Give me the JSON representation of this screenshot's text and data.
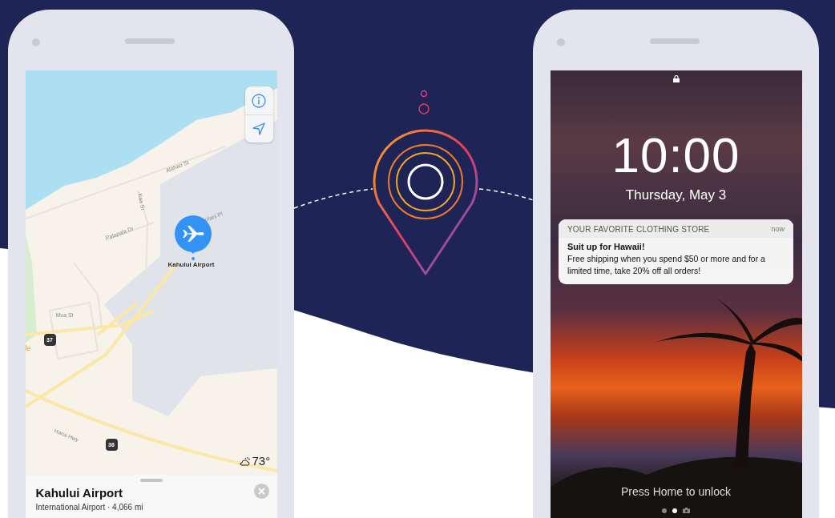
{
  "map_phone": {
    "map": {
      "labels": [
        {
          "kind": "street",
          "text": "Alahao St"
        },
        {
          "kind": "street",
          "text": "Kaa St"
        },
        {
          "kind": "street",
          "text": "Palapala Dr"
        },
        {
          "kind": "street",
          "text": "olani Pl"
        },
        {
          "kind": "street",
          "text": "Mua St"
        },
        {
          "kind": "street",
          "text": "Hana Hwy"
        },
        {
          "kind": "shield",
          "text": "37"
        },
        {
          "kind": "shield",
          "text": "36"
        },
        {
          "kind": "place",
          "text": "le"
        }
      ],
      "controls": [
        {
          "kind": "info"
        },
        {
          "kind": "location"
        }
      ],
      "pin_label": "Kahului Airport",
      "weather": "73°"
    },
    "place_card": {
      "title": "Kahului Airport",
      "subtitle": "International Airport · 4,066 mi"
    }
  },
  "lock_phone": {
    "time": "10:00",
    "date": "Thursday, May 3",
    "notification": {
      "app": "YOUR FAVORITE CLOTHING STORE",
      "time": "now",
      "title": "Suit up for Hawaii!",
      "body": "Free shipping when you spend $50 or more and for a limited time, take 20% off all orders!"
    },
    "hint": "Press Home to unlock",
    "page_indicators": [
      {
        "kind": "dot",
        "selected": false
      },
      {
        "kind": "dot",
        "selected": true
      },
      {
        "kind": "camera"
      }
    ]
  }
}
